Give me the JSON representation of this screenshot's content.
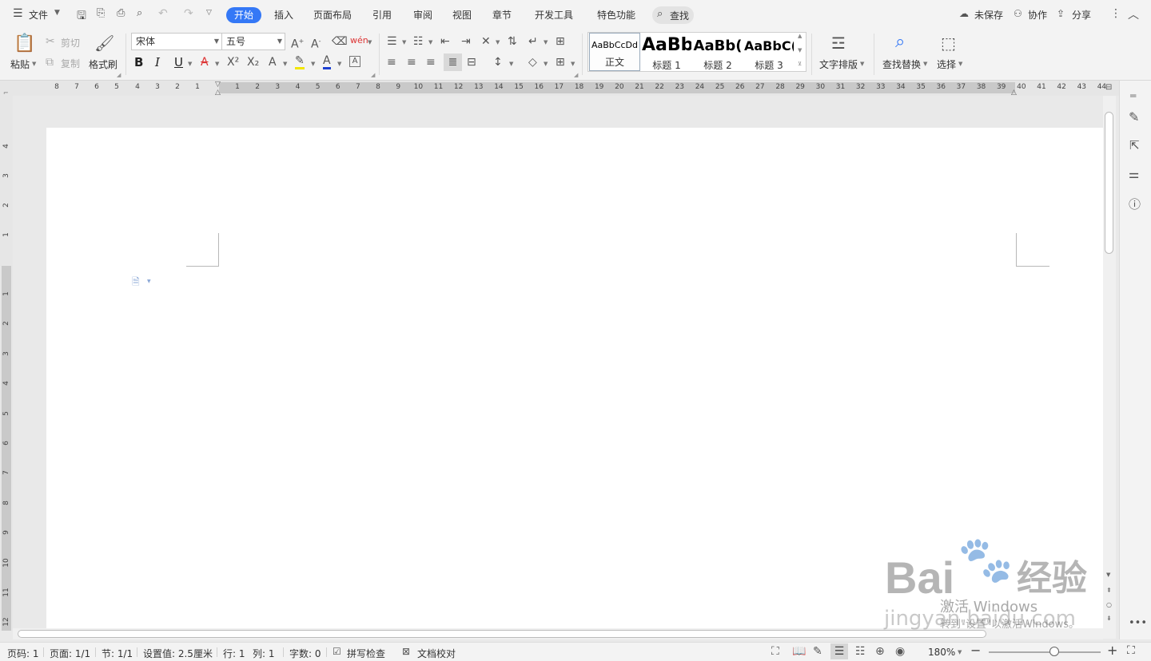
{
  "menu": {
    "file": "文件",
    "tabs": [
      "开始",
      "插入",
      "页面布局",
      "引用",
      "审阅",
      "视图",
      "章节",
      "开发工具",
      "特色功能"
    ],
    "search": "查找",
    "unsaved": "未保存",
    "collab": "协作",
    "share": "分享"
  },
  "ribbon": {
    "paste": "粘贴",
    "cut": "剪切",
    "copy": "复制",
    "format_painter": "格式刷",
    "font_name": "宋体",
    "font_size": "五号",
    "bold": "B",
    "italic": "I",
    "underline": "U",
    "styles": [
      {
        "preview": "AaBbCcDd",
        "name": "正文"
      },
      {
        "preview": "AaBb",
        "name": "标题 1"
      },
      {
        "preview": "AaBb(",
        "name": "标题 2"
      },
      {
        "preview": "AaBbC(",
        "name": "标题 3"
      }
    ],
    "text_layout": "文字排版",
    "find_replace": "查找替换",
    "select": "选择"
  },
  "ruler": {
    "left": [
      "8",
      "7",
      "6",
      "5",
      "4",
      "3",
      "2",
      "1"
    ],
    "right": [
      "1",
      "2",
      "3",
      "4",
      "5",
      "6",
      "7",
      "8",
      "9",
      "10",
      "11",
      "12",
      "13",
      "14",
      "15",
      "16",
      "17",
      "18",
      "19",
      "20",
      "21",
      "22",
      "23",
      "24",
      "25",
      "26",
      "27",
      "28",
      "29",
      "30",
      "31",
      "32",
      "33",
      "34",
      "35",
      "36",
      "37",
      "38",
      "39",
      "40",
      "41",
      "42",
      "43",
      "44"
    ],
    "vertical_top": [
      "4",
      "3",
      "2",
      "1"
    ],
    "vertical_bottom": [
      "1",
      "2",
      "3",
      "4",
      "5",
      "6",
      "7",
      "8",
      "9",
      "10",
      "11",
      "12"
    ]
  },
  "status": {
    "page_num": "页码: 1",
    "pages": "页面: 1/1",
    "section": "节: 1/1",
    "setting": "设置值: 2.5厘米",
    "row": "行: 1",
    "col": "列: 1",
    "words": "字数: 0",
    "spell": "拼写检查",
    "proof": "文档校对",
    "zoom": "180%"
  },
  "watermark": {
    "brand": "Bai",
    "brand2": "经验",
    "activate": "激活 Windows",
    "activate2": "转到\"设置\"以激活Windows。",
    "url": "jingyan.baidu.com"
  }
}
